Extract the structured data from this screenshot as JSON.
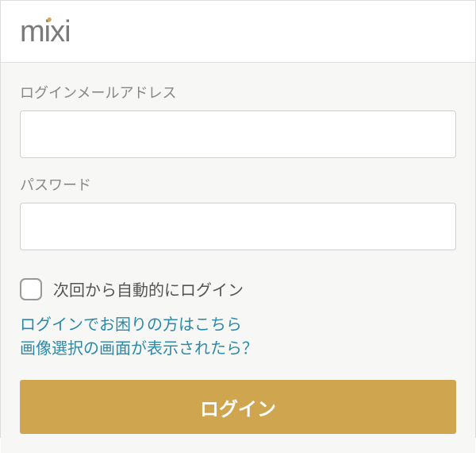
{
  "header": {
    "logo_text": "mixi"
  },
  "form": {
    "email_label": "ログインメールアドレス",
    "email_value": "",
    "password_label": "パスワード",
    "password_value": "",
    "remember_label": "次回から自動的にログイン",
    "help_link_1": "ログインでお困りの方はこちら",
    "help_link_2": "画像選択の画面が表示されたら？",
    "login_button": "ログイン"
  },
  "colors": {
    "accent": "#cfa54f",
    "link": "#2b8aa8",
    "text_muted": "#888"
  }
}
